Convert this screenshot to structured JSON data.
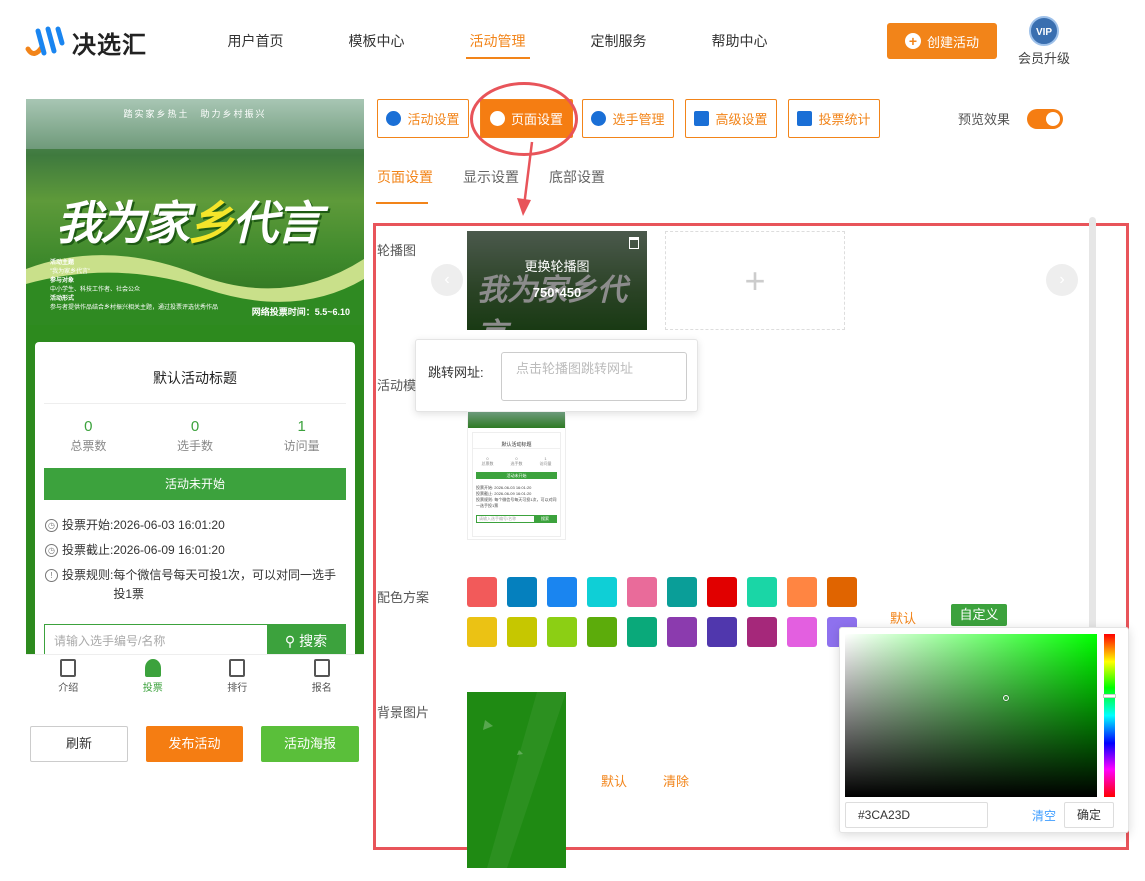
{
  "header": {
    "brand": "决选汇",
    "nav": [
      "用户首页",
      "模板中心",
      "活动管理",
      "定制服务",
      "帮助中心"
    ],
    "create_button": "创建活动",
    "vip_badge": "VIP",
    "vip_label": "会员升级"
  },
  "preview": {
    "banner_top": "踏实家乡热土　助力乡村振兴",
    "banner_title_a": "我为家",
    "banner_title_b": "乡",
    "banner_title_c": "代言",
    "banner_info": [
      "活动主题",
      "\"我为家乡代言\"",
      "参与对象",
      "中小学生、科技工作者、社会公众",
      "活动形式",
      "参与者提供作品结合乡村振兴相关主题，通过投票评选优秀作品"
    ],
    "banner_time": "网络投票时间：5.5~6.10",
    "activity_title": "默认活动标题",
    "stats": [
      {
        "value": "0",
        "label": "总票数"
      },
      {
        "value": "0",
        "label": "选手数"
      },
      {
        "value": "1",
        "label": "访问量"
      }
    ],
    "status_button": "活动未开始",
    "vote_start_label": "投票开始:",
    "vote_start": "2026-06-03 16:01:20",
    "vote_end_label": "投票截止:",
    "vote_end": "2026-06-09 16:01:20",
    "vote_rule_label": "投票规则:",
    "vote_rule": "每个微信号每天可投1次，可以对同一选手投1票",
    "search_placeholder": "请输入选手编号/名称",
    "search_button": "搜索",
    "tabbar": [
      "介绍",
      "投票",
      "排行",
      "报名"
    ]
  },
  "actions": {
    "refresh": "刷新",
    "publish": "发布活动",
    "poster": "活动海报"
  },
  "settings": {
    "tabs": [
      "活动设置",
      "页面设置",
      "选手管理",
      "高级设置",
      "投票统计"
    ],
    "active_tab": "页面设置",
    "preview_label": "预览效果",
    "preview_on": true,
    "subtabs": [
      "页面设置",
      "显示设置",
      "底部设置"
    ],
    "carousel_label": "轮播图",
    "carousel_change": "更换轮播图",
    "carousel_size": "750*450",
    "jump_url_label": "跳转网址:",
    "jump_url_placeholder": "点击轮播图跳转网址",
    "template_label": "活动模",
    "color_label": "配色方案",
    "colors": [
      "#f25a5a",
      "#0580be",
      "#1a85f0",
      "#0fcfd6",
      "#e96b9a",
      "#0a9e98",
      "#e10000",
      "#1ad6a6",
      "#ff8542",
      "#e06400",
      "#ebc214",
      "#c6c700",
      "#8ccf14",
      "#5cac0b",
      "#0aa97a",
      "#8b3bae",
      "#5037ad",
      "#a5287a",
      "#e35fe0",
      "#8e71ee"
    ],
    "color_default": "默认",
    "color_custom": "自定义",
    "bg_label": "背景图片",
    "bg_default": "默认",
    "bg_clear": "清除"
  },
  "color_picker": {
    "hex_value": "#3CA23D",
    "clear": "清空",
    "confirm": "确定"
  }
}
